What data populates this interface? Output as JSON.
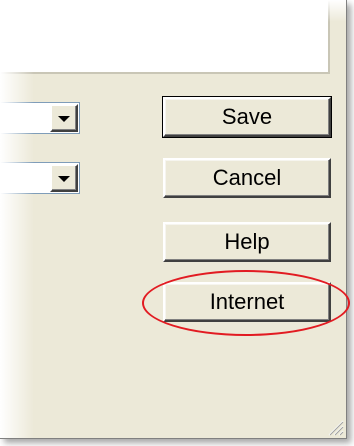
{
  "buttons": {
    "save": "Save",
    "cancel": "Cancel",
    "help": "Help",
    "internet": "Internet"
  },
  "icons": {
    "dropdown": "chevron-down-icon",
    "grip": "resize-grip-icon"
  },
  "colors": {
    "dialog_bg": "#ece9d8",
    "highlight": "#e21b22"
  }
}
